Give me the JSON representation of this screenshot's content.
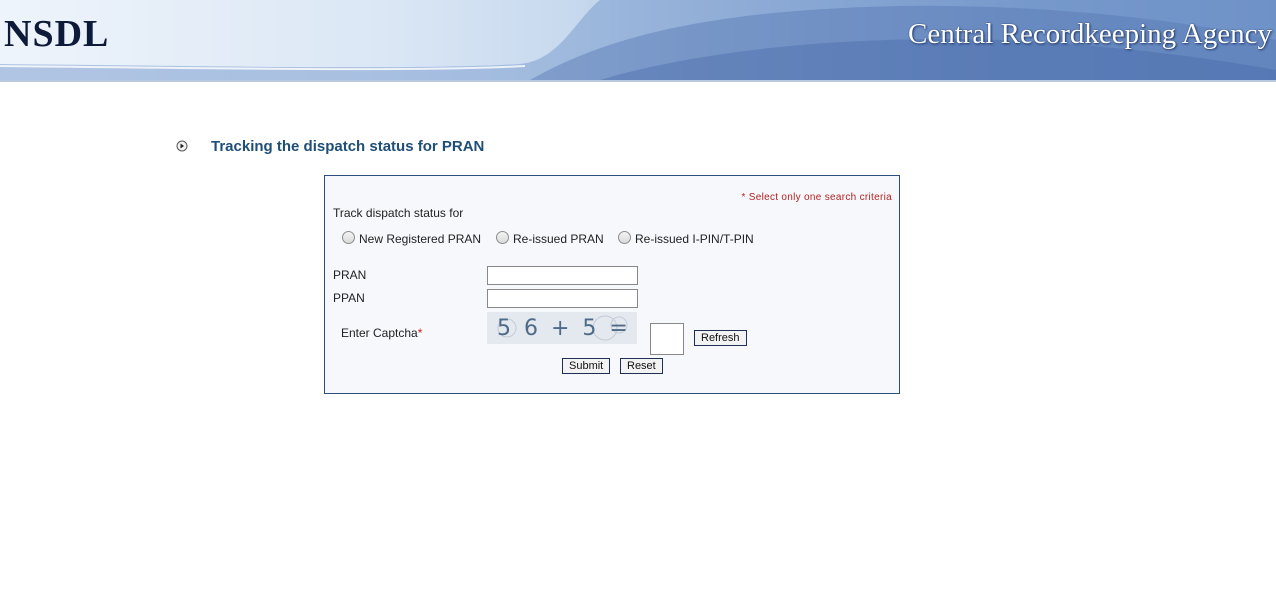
{
  "header": {
    "logo": "NSDL",
    "title": "Central Recordkeeping Agency"
  },
  "page": {
    "heading": "Tracking the dispatch status for PRAN"
  },
  "form": {
    "note": "* Select only one search criteria",
    "track_label": "Track dispatch status for",
    "options": [
      {
        "label": "New Registered PRAN",
        "selected": false
      },
      {
        "label": "Re-issued PRAN",
        "selected": false
      },
      {
        "label": "Re-issued I-PIN/T-PIN",
        "selected": false
      }
    ],
    "pran_label": "PRAN",
    "pran_value": "",
    "ppan_label": "PPAN",
    "ppan_value": "",
    "captcha_label": "Enter Captcha",
    "captcha_required": "*",
    "captcha_text": "5 6 + 5 =",
    "captcha_value": "",
    "refresh_label": "Refresh",
    "submit_label": "Submit",
    "reset_label": "Reset"
  },
  "colors": {
    "heading": "#1f4e79",
    "form_border": "#2e4f7d",
    "required": "#d21b1b"
  }
}
